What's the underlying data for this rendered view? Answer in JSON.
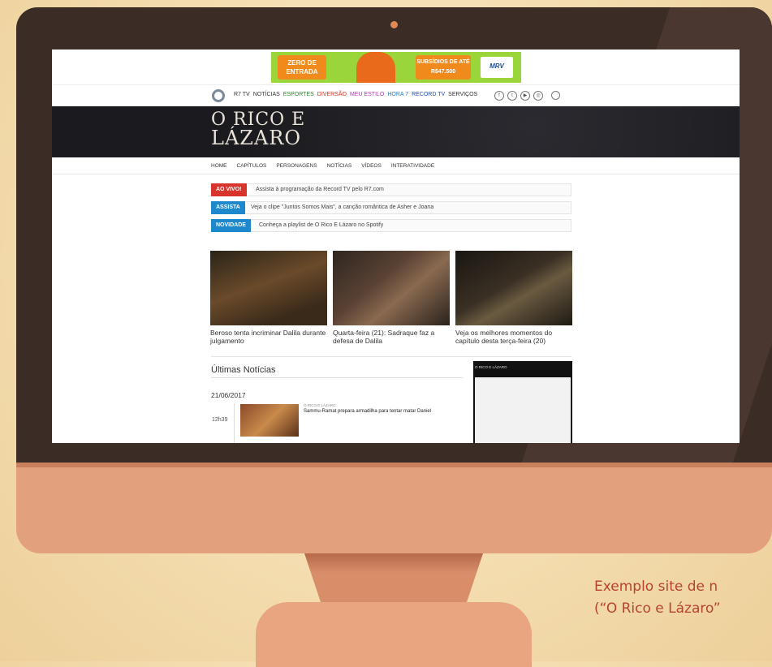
{
  "caption": {
    "line1": "Exemplo site de n",
    "line2": "(“O Rico e Lázaro”"
  },
  "ad": {
    "left_text": "ZERO DE ENTRADA",
    "mid_text": "SUBSÍDIOS DE ATÉ R$47.500",
    "logo": "MRV"
  },
  "topnav": {
    "links": [
      "R7 TV",
      "NOTÍCIAS",
      "ESPORTES",
      "DIVERSÃO",
      "MEU ESTILO",
      "HORA 7",
      "RECORD TV",
      "SERVIÇOS"
    ],
    "link_colors": [
      "#333333",
      "#333333",
      "#2a8a2a",
      "#e0301e",
      "#b03ab0",
      "#1f7fd0",
      "#1f4fb0",
      "#333333"
    ]
  },
  "show": {
    "logo_line1": "O RICO E",
    "logo_line2": "LÁZARO"
  },
  "secnav": [
    "HOME",
    "CAPÍTULOS",
    "PERSONAGENS",
    "NOTÍCIAS",
    "VÍDEOS",
    "INTERATIVIDADE"
  ],
  "alerts": [
    {
      "tag": "AO VIVO!",
      "text": "Assista à programação da Record TV pelo R7.com",
      "color": "#d9342b"
    },
    {
      "tag": "ASSISTA",
      "text": "Veja o clipe \"Juntos Somos Mais\", a canção romântica de Asher e Joana",
      "color": "#1e88cc"
    },
    {
      "tag": "NOVIDADE",
      "text": "Conheça a playlist de O Rico E Lázaro no Spotify",
      "color": "#1e88cc"
    }
  ],
  "cards": [
    {
      "caption": "Beroso tenta incriminar Dalila durante julgamento"
    },
    {
      "caption": "Quarta-feira (21): Sadraque faz a defesa de Dalila"
    },
    {
      "caption": "Veja os melhores momentos do capítulo desta terça-feira (20)"
    }
  ],
  "latest": {
    "title": "Últimas Notícias",
    "date": "21/06/2017",
    "item": {
      "time": "12h39",
      "kicker": "O RICO E LÁZARO",
      "title": "Sammu-Ramat prepara armadilha para tentar matar Daniel"
    }
  },
  "video": {
    "header": "O RICO E LÁZARO"
  }
}
